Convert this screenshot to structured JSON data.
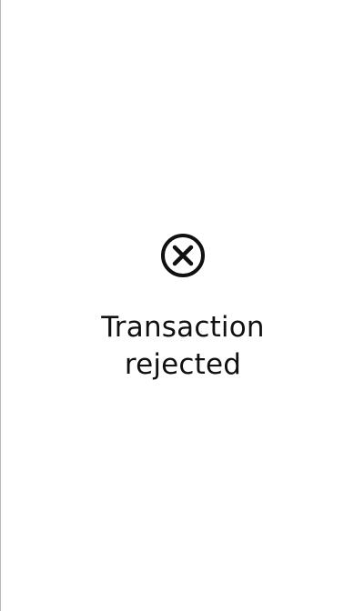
{
  "status": {
    "icon": "close-circle-icon",
    "message_line1": "Transaction",
    "message_line2": "rejected"
  },
  "colors": {
    "background": "#ffffff",
    "text": "#111111",
    "icon": "#111111"
  }
}
